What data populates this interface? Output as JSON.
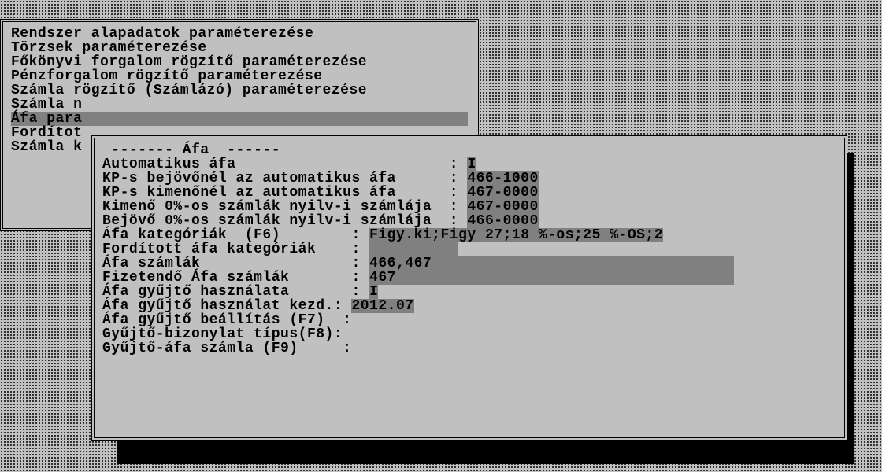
{
  "menu": {
    "items": [
      "Rendszer alapadatok paraméterezése",
      "Törzsek paraméterezése",
      "Főkönyvi forgalom rögzítő paraméterezése",
      "Pénzforgalom rögzítő paraméterezése",
      "Számla rögzítő (Számlázó) paraméterezése",
      "Számla n",
      "Áfa para",
      "Fordítot",
      "Számla k"
    ],
    "selected_index": 6
  },
  "dialog": {
    "title": " ------- Áfa  ------",
    "rows": [
      {
        "label": "Automatikus áfa                        : ",
        "value": "I",
        "pad": 0
      },
      {
        "label": "KP-s bejövőnél az automatikus áfa      : ",
        "value": "466-1000",
        "pad": 0
      },
      {
        "label": "KP-s kimenőnél az automatikus áfa      : ",
        "value": "467-0000",
        "pad": 0
      },
      {
        "label": "Kimenő 0%-os számlák nyilv-i számlája  : ",
        "value": "467-0000",
        "pad": 0
      },
      {
        "label": "Bejövő 0%-os számlák nyilv-i számlája  : ",
        "value": "466-0000",
        "pad": 0
      },
      {
        "label": "Áfa kategóriák  (F6)        : ",
        "value": "Figy.ki;Figy 27;18 %-os;25 %-OS;2",
        "pad": 0
      },
      {
        "label": "Fordított áfa kategóriák    : ",
        "value": "          ",
        "pad": 0
      },
      {
        "label": "Áfa számlák                 : ",
        "value": "466,467",
        "pad": 34
      },
      {
        "label": "Fizetendő Áfa számlák       : ",
        "value": "467",
        "pad": 38
      },
      {
        "label": "Áfa gyűjtő használata       : ",
        "value": "I",
        "pad": 0
      },
      {
        "label": "Áfa gyűjtő használat kezd.: ",
        "value": "2012.07",
        "pad": 0
      },
      {
        "label": "Áfa gyűjtő beállítás (F7)  :",
        "value": "",
        "pad": 0
      },
      {
        "label": "Gyűjtő-bizonylat típus(F8):",
        "value": "",
        "pad": 0
      },
      {
        "label": "Gyűjtő-áfa számla (F9)     :",
        "value": "",
        "pad": 0
      }
    ]
  }
}
